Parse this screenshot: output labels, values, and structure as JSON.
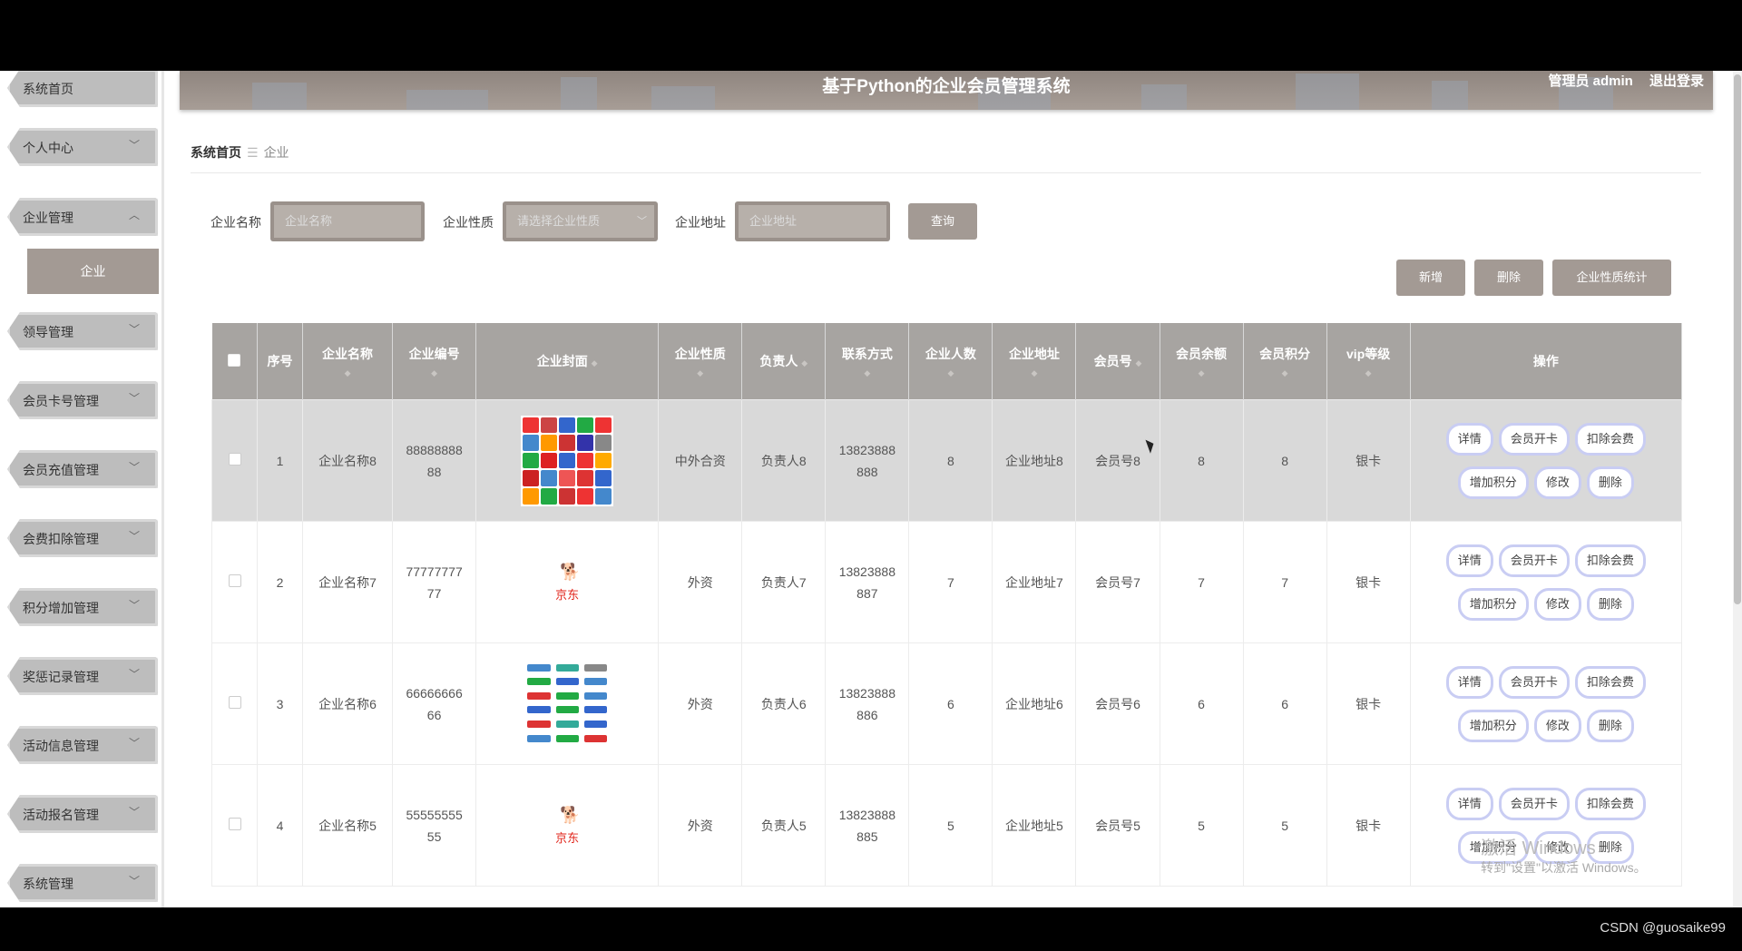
{
  "header": {
    "title": "基于Python的企业会员管理系统",
    "user": "管理员 admin",
    "logout": "退出登录"
  },
  "sidebar": {
    "items": [
      {
        "label": "系统首页"
      },
      {
        "label": "个人中心"
      },
      {
        "label": "企业管理"
      },
      {
        "label": "领导管理"
      },
      {
        "label": "会员卡号管理"
      },
      {
        "label": "会员充值管理"
      },
      {
        "label": "会费扣除管理"
      },
      {
        "label": "积分增加管理"
      },
      {
        "label": "奖惩记录管理"
      },
      {
        "label": "活动信息管理"
      },
      {
        "label": "活动报名管理"
      },
      {
        "label": "系统管理"
      }
    ],
    "sub": "企业"
  },
  "breadcrumb": {
    "home": "系统首页",
    "current": "企业"
  },
  "search": {
    "name_label": "企业名称",
    "name_placeholder": "企业名称",
    "nature_label": "企业性质",
    "nature_placeholder": "请选择企业性质",
    "addr_label": "企业地址",
    "addr_placeholder": "企业地址",
    "query": "查询"
  },
  "actions": {
    "add": "新增",
    "delete": "删除",
    "stats": "企业性质统计"
  },
  "table": {
    "headers": [
      "序号",
      "企业名称",
      "企业编号",
      "企业封面",
      "企业性质",
      "负责人",
      "联系方式",
      "企业人数",
      "企业地址",
      "会员号",
      "会员余额",
      "会员积分",
      "vip等级",
      "操作"
    ],
    "rows": [
      {
        "no": "1",
        "name": "企业名称8",
        "code": "8888888888",
        "nature": "中外合资",
        "leader": "负责人8",
        "phone": "13823888888",
        "count": "8",
        "addr": "企业地址8",
        "member": "会员号8",
        "balance": "8",
        "points": "8",
        "vip": "银卡"
      },
      {
        "no": "2",
        "name": "企业名称7",
        "code": "7777777777",
        "nature": "外资",
        "leader": "负责人7",
        "phone": "13823888887",
        "count": "7",
        "addr": "企业地址7",
        "member": "会员号7",
        "balance": "7",
        "points": "7",
        "vip": "银卡"
      },
      {
        "no": "3",
        "name": "企业名称6",
        "code": "6666666666",
        "nature": "外资",
        "leader": "负责人6",
        "phone": "13823888886",
        "count": "6",
        "addr": "企业地址6",
        "member": "会员号6",
        "balance": "6",
        "points": "6",
        "vip": "银卡"
      },
      {
        "no": "4",
        "name": "企业名称5",
        "code": "5555555555",
        "nature": "外资",
        "leader": "负责人5",
        "phone": "13823888885",
        "count": "5",
        "addr": "企业地址5",
        "member": "会员号5",
        "balance": "5",
        "points": "5",
        "vip": "银卡"
      }
    ],
    "ops": [
      "详情",
      "会员开卡",
      "扣除会费",
      "增加积分",
      "修改",
      "删除"
    ],
    "jd_logo": "京东"
  },
  "watermark": {
    "line1": "激活 Windows",
    "line2": "转到\"设置\"以激活 Windows。"
  },
  "credit": "CSDN @guosaike99"
}
